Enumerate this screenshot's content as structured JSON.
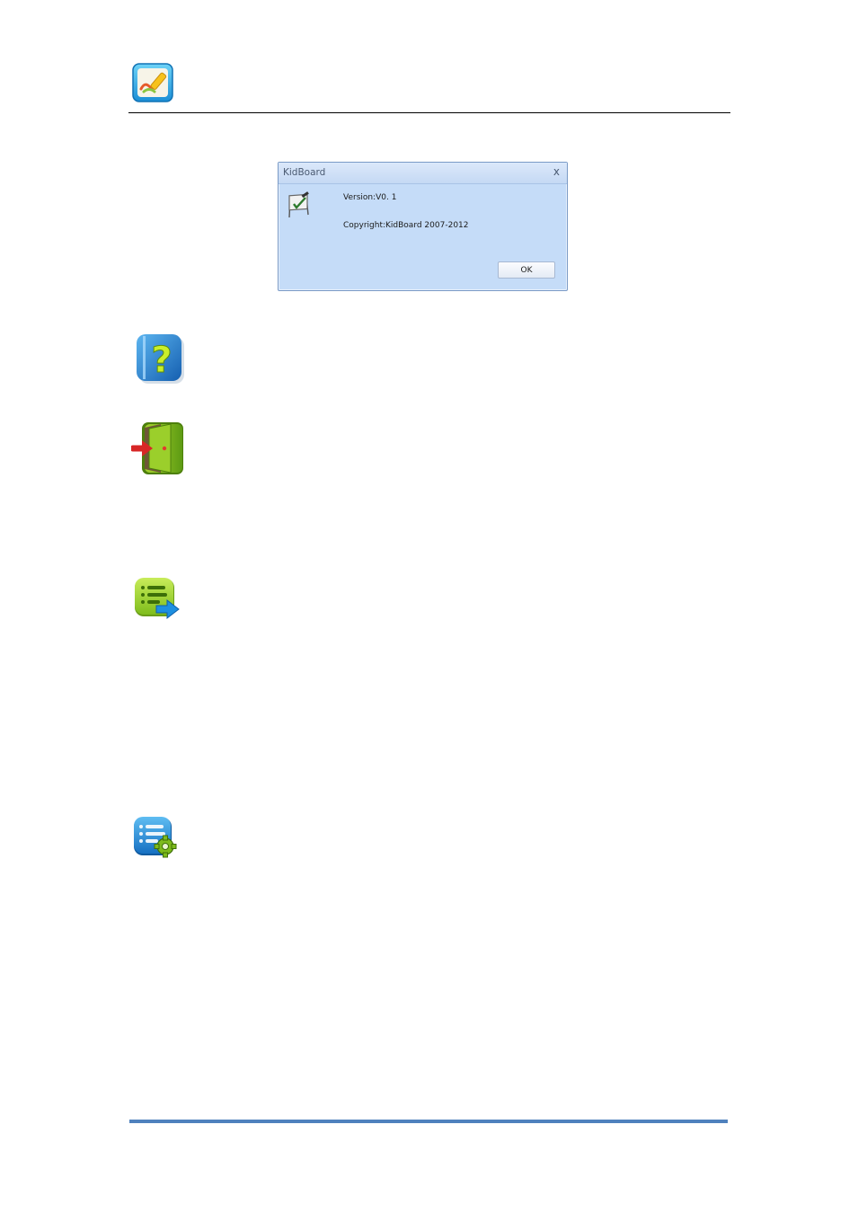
{
  "header": {
    "logo_icon": "kidboard-pen-logo-icon"
  },
  "dialog": {
    "title": "KidBoard",
    "close_glyph": "x",
    "version_text": "Version:V0. 1",
    "copyright_text": "Copyright:KidBoard 2007-2012",
    "ok_label": "OK",
    "icon": "whiteboard-check-icon"
  },
  "icons": [
    "help-icon",
    "exit-door-icon",
    "list-arrow-icon",
    "list-settings-icon"
  ],
  "colors": {
    "footer_rule": "#4f81bd",
    "dialog_bg": "#c5dcf8"
  }
}
